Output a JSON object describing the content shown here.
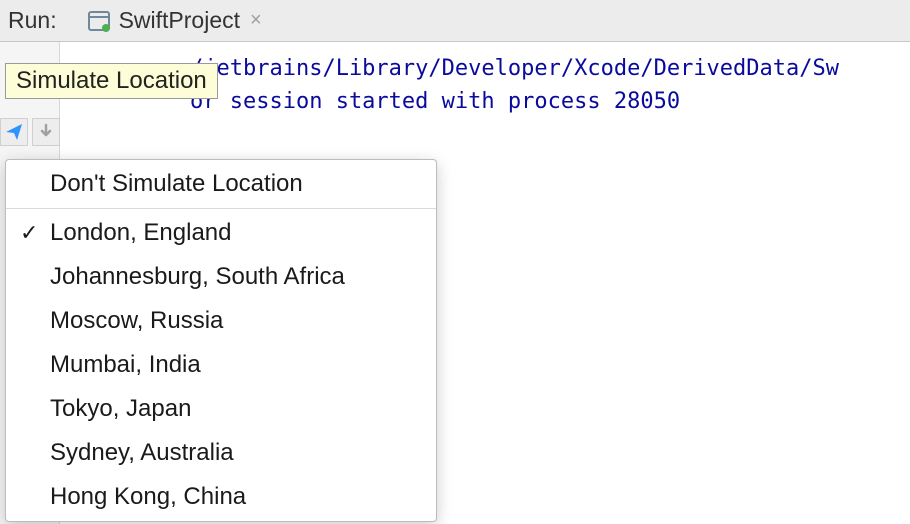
{
  "header": {
    "run_label": "Run:",
    "tab_name": "SwiftProject"
  },
  "tooltip": {
    "text": "Simulate Location"
  },
  "console": {
    "line1": "/jetbrains/Library/Developer/Xcode/DerivedData/Sw",
    "line2": "or session started with process 28050"
  },
  "menu": {
    "no_simulate": "Don't Simulate Location",
    "items": [
      {
        "checked": true,
        "label": "London, England"
      },
      {
        "checked": false,
        "label": "Johannesburg, South Africa"
      },
      {
        "checked": false,
        "label": "Moscow, Russia"
      },
      {
        "checked": false,
        "label": "Mumbai, India"
      },
      {
        "checked": false,
        "label": "Tokyo, Japan"
      },
      {
        "checked": false,
        "label": "Sydney, Australia"
      },
      {
        "checked": false,
        "label": "Hong Kong, China"
      }
    ]
  },
  "checkmark_glyph": "✓"
}
